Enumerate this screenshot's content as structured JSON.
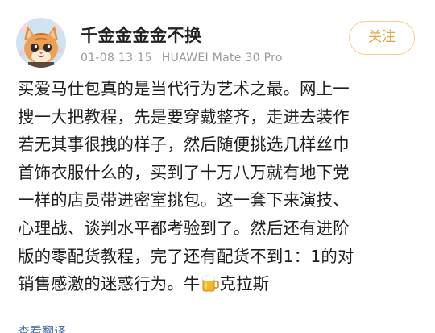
{
  "post": {
    "username": "千金金金金不换",
    "time": "01-08 13:15",
    "device": "HUAWEI Mate 30 Pro",
    "follow_label": "关注",
    "body_lines": [
      "买爱马仕包真的是当代行为艺术之最。网上一",
      "搜一大把教程，先是要穿戴整齐，走进去装作",
      "若无其事很拽的样子，然后随便挑选几样丝巾",
      "首饰衣服什么的，买到了十万八万就有地下党",
      "一样的店员带进密室挑包。这一套下来演技、",
      "心理战、谈判水平都考验到了。然后还有进阶",
      "版的零配货教程，完了还有配货不到1：1的对"
    ],
    "last_line_before_icon": "销售感激的迷惑行为。牛",
    "last_line_after_icon": "克拉斯",
    "inline_icon": "beer-mug-icon",
    "cutoff_text": "查看翻译"
  },
  "colors": {
    "follow_accent": "#e8a33a",
    "follow_border": "#f3cf8a",
    "meta_gray": "#9a9a9a"
  },
  "avatar": {
    "icon": "orange-cat-avatar"
  }
}
